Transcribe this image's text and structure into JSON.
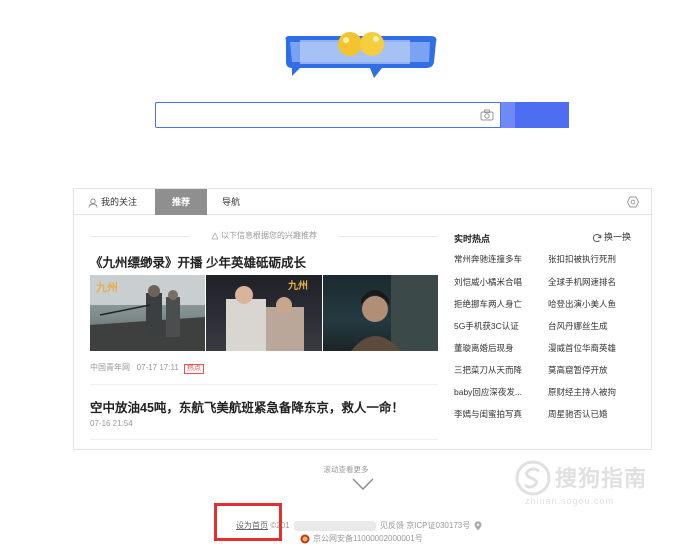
{
  "search": {
    "value": "",
    "button_label": ""
  },
  "tabs": [
    {
      "label": "我的关注"
    },
    {
      "label": "推荐"
    },
    {
      "label": "导航"
    }
  ],
  "recommend_tip": "以下信息根据您的兴趣推荐",
  "news": [
    {
      "title": "《九州缥缈录》开播 少年英雄砥砺成长",
      "source": "中国青年网",
      "time": "07-17 17:11",
      "tag": "热点"
    },
    {
      "title": "空中放油45吨，东航飞美航班紧急备降东京，救人一命！",
      "source": "",
      "time": "07-16 21:54",
      "tag": ""
    }
  ],
  "hot": {
    "title": "实时热点",
    "refresh_label": "换一换",
    "items": [
      "常州奔驰连撞多车",
      "张扣扣被执行死刑",
      "刘恺威小橘米合唱",
      "全球手机网速排名",
      "拒绝挪车两人身亡",
      "哈登出演小美人鱼",
      "5G手机获3C认证",
      "台风丹娜丝生成",
      "董璇离婚后现身",
      "漫威首位华裔英雄",
      "三把菜刀从天而降",
      "莫高窟暂停开放",
      "baby回应深夜发...",
      "原财经主持人被拘",
      "李嫣与闺蜜拍写真",
      "周星驰否认已婚"
    ]
  },
  "scroll_more": "滚动查看更多",
  "footer": {
    "set_home": "设为首页",
    "copyright_prefix": "©201",
    "feedback": "见反馈",
    "icp": "京ICP证030173号",
    "police": "京公网安备11000002000001号"
  },
  "watermark": {
    "brand": "搜狗指南",
    "url": "zhinan.sogou.com"
  },
  "colors": {
    "accent": "#4e6ef2",
    "tab_active": "#8f8f8f",
    "hot_tag": "#f24e4e",
    "highlight_box": "#e52e2e"
  }
}
